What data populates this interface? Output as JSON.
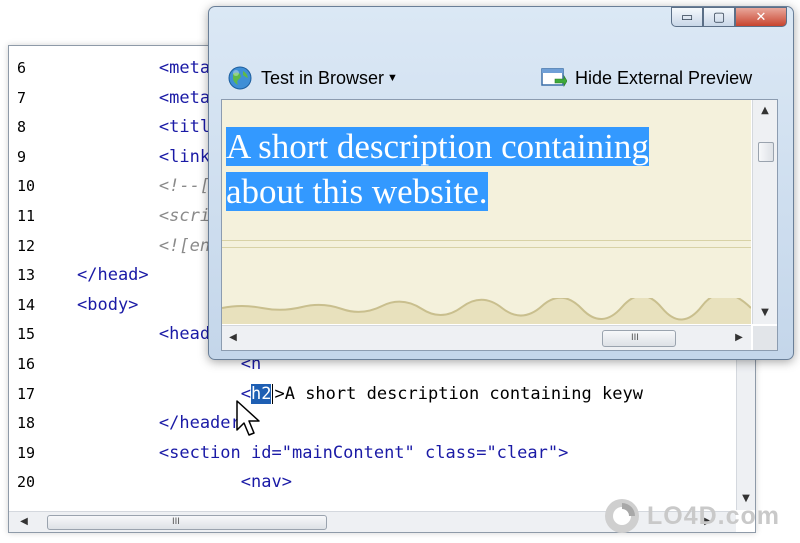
{
  "editor": {
    "lines": [
      {
        "n": "6",
        "code": [
          {
            "t": "        <meta",
            "c": "tag"
          }
        ]
      },
      {
        "n": "7",
        "code": [
          {
            "t": "        <meta",
            "c": "tag"
          }
        ]
      },
      {
        "n": "8",
        "code": [
          {
            "t": "        <title",
            "c": "tag"
          }
        ]
      },
      {
        "n": "9",
        "code": [
          {
            "t": "        <link",
            "c": "tag"
          }
        ]
      },
      {
        "n": "10",
        "code": [
          {
            "t": "        <!--[i",
            "c": "cmt"
          }
        ]
      },
      {
        "n": "11",
        "code": [
          {
            "t": "        <scrip",
            "c": "cmt"
          }
        ]
      },
      {
        "n": "12",
        "code": [
          {
            "t": "        <![end",
            "c": "cmt"
          }
        ]
      },
      {
        "n": "13",
        "code": [
          {
            "t": "</head>",
            "c": "tag"
          }
        ]
      },
      {
        "n": "14",
        "code": [
          {
            "t": "<body>",
            "c": "tag"
          }
        ]
      },
      {
        "n": "15",
        "code": [
          {
            "t": "        <heade",
            "c": "tag"
          }
        ]
      },
      {
        "n": "16",
        "code": [
          {
            "t": "                <h",
            "c": "tag"
          }
        ]
      },
      {
        "n": "17",
        "code": [
          {
            "t": "                <",
            "c": "tag"
          },
          {
            "t": "h2",
            "c": "sel"
          },
          {
            "t": "",
            "c": "caret"
          },
          {
            "t": ">A short description containing keyw",
            "c": "txt"
          }
        ]
      },
      {
        "n": "18",
        "code": [
          {
            "t": "        </header",
            "c": "tag"
          }
        ]
      },
      {
        "n": "19",
        "code": [
          {
            "t": "        <section ",
            "c": "tag"
          },
          {
            "t": "id=",
            "c": "attr"
          },
          {
            "t": "\"mainContent\"",
            "c": "str"
          },
          {
            "t": " class=",
            "c": "attr"
          },
          {
            "t": "\"clear\"",
            "c": "str"
          },
          {
            "t": ">",
            "c": "tag"
          }
        ]
      },
      {
        "n": "20",
        "code": [
          {
            "t": "                <nav>",
            "c": "tag"
          }
        ]
      }
    ],
    "scroll_thumb_grip": "III"
  },
  "preview": {
    "test_in_browser_label": "Test in Browser",
    "hide_preview_label": "Hide External Preview",
    "selected_text_line1": "A short description containing",
    "selected_text_line2": "about this website.",
    "scroll_thumb_grip": "III",
    "minimize_glyph": "▭",
    "maximize_glyph": "▢",
    "close_glyph": "✕"
  },
  "watermark": {
    "text": "LO4D.com"
  },
  "colors": {
    "selection": "#3399ff",
    "page_background": "#f4f1dc",
    "tag_color": "#1a1aa6",
    "close_button": "#c8442e"
  }
}
